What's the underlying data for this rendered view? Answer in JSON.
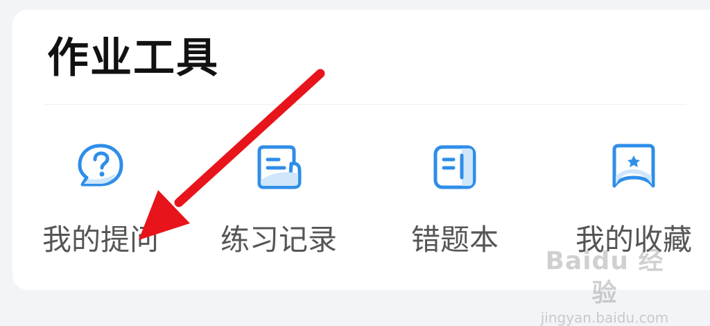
{
  "section": {
    "title": "作业工具"
  },
  "tools": [
    {
      "label": "我的提问",
      "icon": "question-bubble-icon"
    },
    {
      "label": "练习记录",
      "icon": "practice-record-icon"
    },
    {
      "label": "错题本",
      "icon": "mistake-book-icon"
    },
    {
      "label": "我的收藏",
      "icon": "favorites-bookmark-icon"
    }
  ],
  "annotation": {
    "arrow_color": "#e8141b",
    "icon": "red-arrow-icon"
  },
  "watermark": {
    "logo": "Baidu 经验",
    "url": "jingyan.baidu.com"
  },
  "colors": {
    "icon_stroke": "#2f8ee8",
    "icon_fill": "#cfe6fb",
    "label": "#555555",
    "title": "#111111"
  }
}
